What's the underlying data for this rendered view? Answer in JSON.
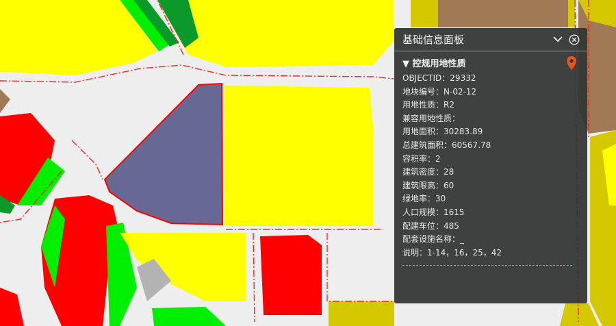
{
  "panel": {
    "title": "基础信息面板",
    "section_title": "控规用地性质",
    "section_arrow": "▼",
    "fields": [
      {
        "label": "OBJECTID：",
        "value": "29332"
      },
      {
        "label": "地块编号：",
        "value": "N-02-12"
      },
      {
        "label": "用地性质：",
        "value": "R2"
      },
      {
        "label": "兼容用地性质：",
        "value": ""
      },
      {
        "label": "用地面积：",
        "value": "30283.89"
      },
      {
        "label": "总建筑面积：",
        "value": "60567.78"
      },
      {
        "label": "容积率：",
        "value": "2"
      },
      {
        "label": "建筑密度：",
        "value": "28"
      },
      {
        "label": "建筑限高：",
        "value": "60"
      },
      {
        "label": "绿地率：",
        "value": "30"
      },
      {
        "label": "人口规模：",
        "value": "1615"
      },
      {
        "label": "配建车位：",
        "value": "485"
      },
      {
        "label": "配套设施名称：",
        "value": "_"
      },
      {
        "label": "说明：",
        "value": "1-14，16，25，42"
      }
    ],
    "icons": {
      "collapse": "chevron-down-icon",
      "close": "close-circle-icon",
      "locate": "map-pin-icon"
    }
  },
  "colors": {
    "accent_pin": "#e8531f",
    "selected_parcel": "#676894",
    "residential": "#ffff00",
    "commercial": "#ff0000",
    "green": "#00ee00",
    "road": "#eeeeee",
    "mixed": "#d4c800",
    "brown": "#a07a55"
  }
}
